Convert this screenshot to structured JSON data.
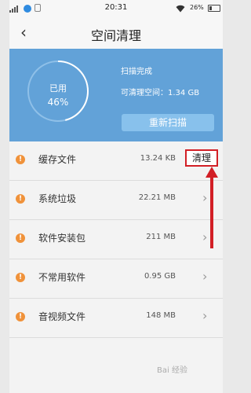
{
  "status_bar": {
    "time": "20:31",
    "battery": "26%",
    "wifi_icon": "wifi-icon"
  },
  "header": {
    "back_icon": "‹",
    "title": "空间清理"
  },
  "storage": {
    "used_label": "已用",
    "used_percent": "46%",
    "used_fraction": 0.46,
    "scan_status": "扫描完成",
    "cleanable_text": "可清理空间：1.34 GB",
    "rescan_label": "重新扫描",
    "colors": {
      "panel": "#62a2d8",
      "button": "#88c1ec"
    }
  },
  "items": [
    {
      "name": "缓存文件",
      "size": "13.24 KB",
      "action": "清理"
    },
    {
      "name": "系统垃圾",
      "size": "22.21 MB"
    },
    {
      "name": "软件安装包",
      "size": "211 MB"
    },
    {
      "name": "不常用软件",
      "size": "0.95 GB"
    },
    {
      "name": "音视频文件",
      "size": "148 MB"
    }
  ],
  "warning_icon_color": "#f0923a",
  "highlight_color": "#d21f26",
  "watermark": "Bai 经验"
}
